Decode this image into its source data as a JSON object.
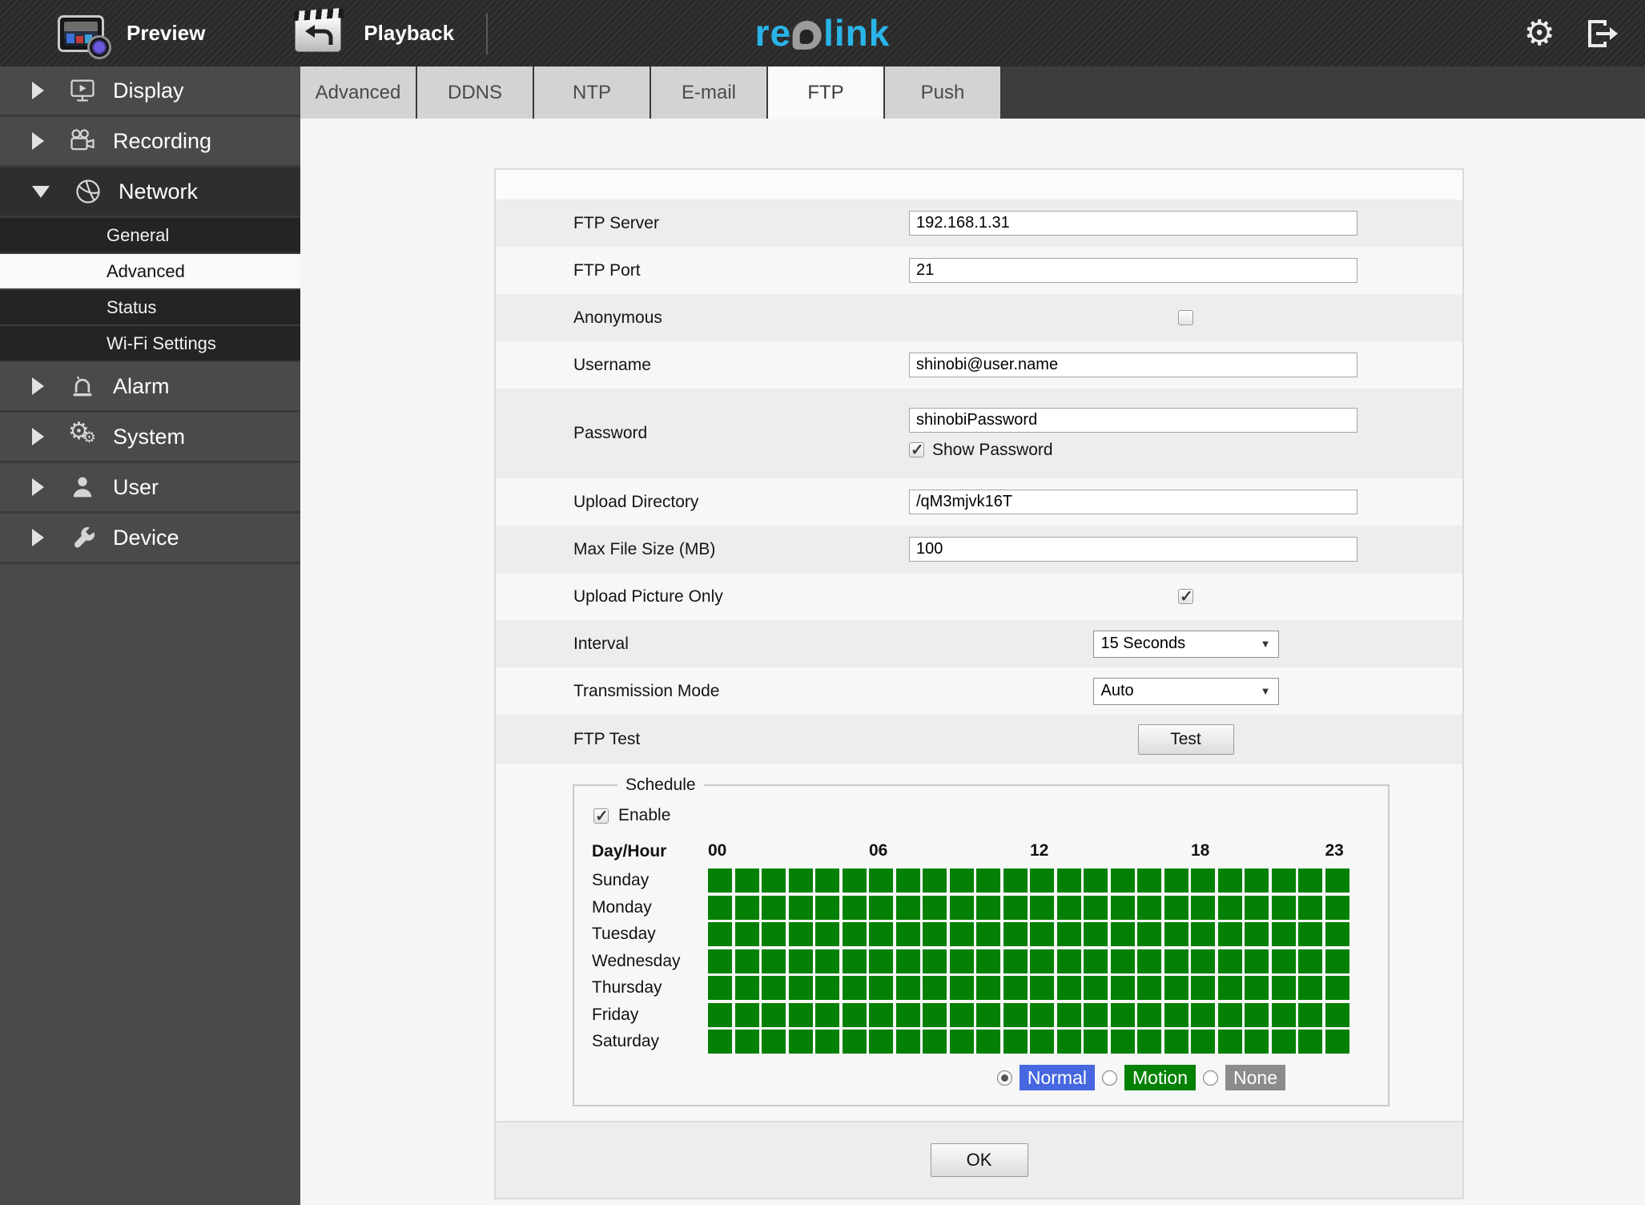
{
  "topbar": {
    "preview_label": "Preview",
    "playback_label": "Playback",
    "logo_text_left": "re",
    "logo_text_right": "link",
    "gear_glyph": "⚙"
  },
  "sidebar": {
    "items": [
      {
        "label": "Display"
      },
      {
        "label": "Recording"
      },
      {
        "label": "Network",
        "expanded": true
      },
      {
        "label": "Alarm"
      },
      {
        "label": "System"
      },
      {
        "label": "User"
      },
      {
        "label": "Device"
      }
    ],
    "network_children": [
      "General",
      "Advanced",
      "Status",
      "Wi-Fi Settings"
    ],
    "selected_child": "Advanced"
  },
  "tabs": {
    "items": [
      "Advanced",
      "DDNS",
      "NTP",
      "E-mail",
      "FTP",
      "Push"
    ],
    "active": "FTP"
  },
  "form": {
    "ftp_server": {
      "label": "FTP Server",
      "value": "192.168.1.31"
    },
    "ftp_port": {
      "label": "FTP Port",
      "value": "21"
    },
    "anonymous": {
      "label": "Anonymous",
      "checked": false
    },
    "username": {
      "label": "Username",
      "value": "shinobi@user.name"
    },
    "password": {
      "label": "Password",
      "value": "shinobiPassword",
      "show_password_label": "Show Password",
      "show_password_checked": true
    },
    "upload_directory": {
      "label": "Upload Directory",
      "value": "/qM3mjvk16T"
    },
    "max_file_size": {
      "label": "Max File Size (MB)",
      "value": "100"
    },
    "upload_picture_only": {
      "label": "Upload Picture Only",
      "checked": true
    },
    "interval": {
      "label": "Interval",
      "value": "15 Seconds"
    },
    "transmission_mode": {
      "label": "Transmission Mode",
      "value": "Auto"
    },
    "ftp_test": {
      "label": "FTP Test",
      "button_label": "Test"
    }
  },
  "schedule": {
    "legend": "Schedule",
    "enable_label": "Enable",
    "enable_checked": true,
    "day_hour_label": "Day/Hour",
    "hour_ticks": [
      {
        "label": "00",
        "col": 0
      },
      {
        "label": "06",
        "col": 6
      },
      {
        "label": "12",
        "col": 12
      },
      {
        "label": "18",
        "col": 18
      },
      {
        "label": "23",
        "col": 23
      }
    ],
    "days": [
      "Sunday",
      "Monday",
      "Tuesday",
      "Wednesday",
      "Thursday",
      "Friday",
      "Saturday"
    ],
    "hours_per_day": 24,
    "cell_state_all": "on",
    "cell_on_color": "#048104",
    "modes": [
      {
        "label": "Normal",
        "color": "#4667e0",
        "selected": true
      },
      {
        "label": "Motion",
        "color": "#048104",
        "selected": false
      },
      {
        "label": "None",
        "color": "#8b8b8b",
        "selected": false
      }
    ]
  },
  "ok_button_label": "OK"
}
